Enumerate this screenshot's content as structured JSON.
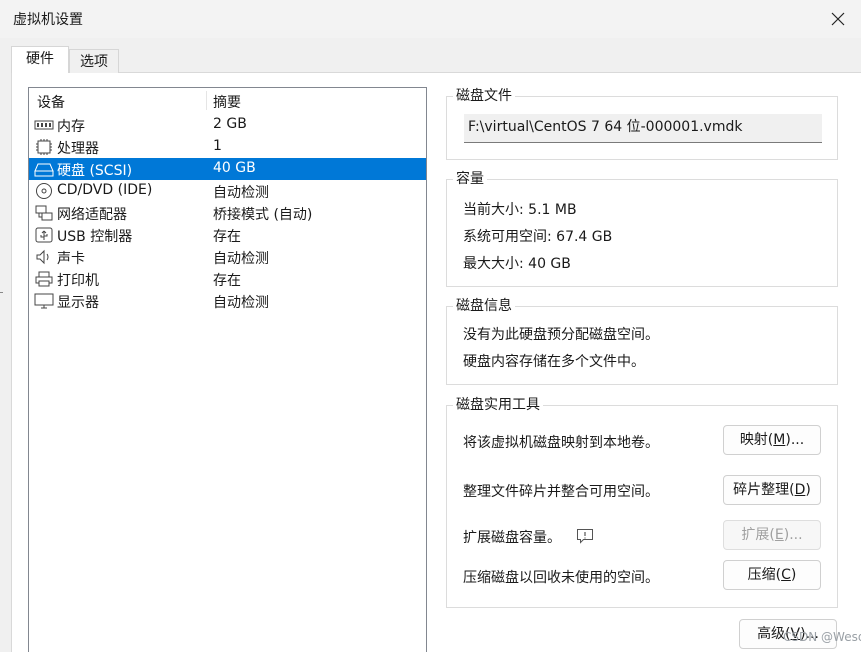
{
  "window": {
    "title": "虚拟机设置",
    "close_icon": "close-icon"
  },
  "tabs": [
    {
      "label": "硬件",
      "active": true
    },
    {
      "label": "选项",
      "active": false
    }
  ],
  "device_list": {
    "columns": [
      "设备",
      "摘要"
    ],
    "rows": [
      {
        "icon": "memory-icon",
        "name": "内存",
        "summary": "2 GB",
        "selected": false
      },
      {
        "icon": "processor-icon",
        "name": "处理器",
        "summary": "1",
        "selected": false
      },
      {
        "icon": "hard-disk-icon",
        "name": "硬盘 (SCSI)",
        "summary": "40 GB",
        "selected": true
      },
      {
        "icon": "cd-dvd-icon",
        "name": "CD/DVD (IDE)",
        "summary": "自动检测",
        "selected": false
      },
      {
        "icon": "network-adapter-icon",
        "name": "网络适配器",
        "summary": "桥接模式 (自动)",
        "selected": false
      },
      {
        "icon": "usb-icon",
        "name": "USB 控制器",
        "summary": "存在",
        "selected": false
      },
      {
        "icon": "sound-card-icon",
        "name": "声卡",
        "summary": "自动检测",
        "selected": false
      },
      {
        "icon": "printer-icon",
        "name": "打印机",
        "summary": "存在",
        "selected": false
      },
      {
        "icon": "display-icon",
        "name": "显示器",
        "summary": "自动检测",
        "selected": false
      }
    ]
  },
  "disk_file": {
    "title": "磁盘文件",
    "path": "F:\\virtual\\CentOS 7 64 位-000001.vmdk"
  },
  "capacity": {
    "title": "容量",
    "current_size": "当前大小: 5.1 MB",
    "system_available": "系统可用空间: 67.4 GB",
    "max_size": "最大大小: 40 GB"
  },
  "disk_info": {
    "title": "磁盘信息",
    "line1": "没有为此硬盘预分配磁盘空间。",
    "line2": "硬盘内容存储在多个文件中。"
  },
  "disk_utilities": {
    "title": "磁盘实用工具",
    "map_desc": "将该虚拟机磁盘映射到本地卷。",
    "map_button": {
      "label": "映射(",
      "key": "M",
      "suffix": ")..."
    },
    "defrag_desc": "整理文件碎片并整合可用空间。",
    "defrag_button": {
      "label": "碎片整理(",
      "key": "D",
      "suffix": ")"
    },
    "expand_desc": "扩展磁盘容量。",
    "expand_info_icon": "comment-info-icon",
    "expand_button": {
      "label": "扩展(",
      "key": "E",
      "suffix": ")...",
      "enabled": false
    },
    "compact_desc": "压缩磁盘以回收未使用的空间。",
    "compact_button": {
      "label": "压缩(",
      "key": "C",
      "suffix": ")"
    }
  },
  "advanced_button": {
    "label": "高级(",
    "key": "V",
    "suffix": ")..."
  },
  "watermark": "CSDN @Wesqun"
}
